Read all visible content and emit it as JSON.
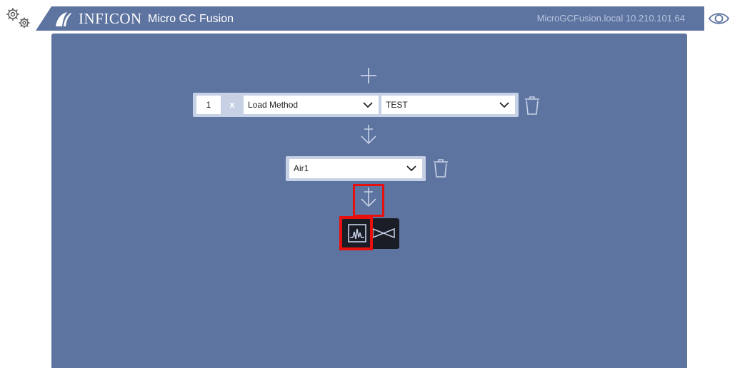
{
  "header": {
    "brand": "INFICON",
    "product": "Micro GC Fusion",
    "host": "MicroGCFusion.local 10.210.101.64",
    "settings_icon": "gears-icon",
    "view_icon": "eye-icon",
    "logo_icon": "inficon-logo-icon"
  },
  "method_step": {
    "number": "1",
    "remove_label": "x",
    "action_value": "Load Method",
    "method_value": "TEST",
    "delete_icon": "trash-icon"
  },
  "stream_step": {
    "stream_value": "Air1",
    "delete_icon": "trash-icon"
  },
  "actions": {
    "add_icon": "plus-icon",
    "insert_icon": "insert-arrow-icon",
    "chromatogram_icon": "chromatogram-icon",
    "valve_icon": "valve-icon"
  },
  "colors": {
    "panel": "#5d73a0",
    "row_bg": "#c6d1e6",
    "highlight": "#e8100d",
    "action_bg": "#1a1d26"
  }
}
